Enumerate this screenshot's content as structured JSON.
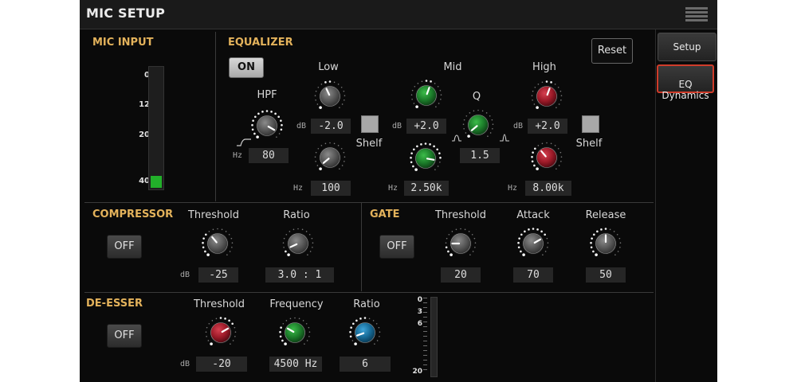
{
  "window": {
    "title": "MIC SETUP"
  },
  "icons": {
    "menu": "hamburger-menu-icon",
    "hpf_shape": "highpass-curve-icon",
    "mid_low_shape": "mid-low-curve-icon",
    "mid_high_shape": "mid-high-curve-icon"
  },
  "colors": {
    "section_title": "#e3b25b",
    "meter_level": "#22b02a",
    "knob_gray": "#585858",
    "knob_green": "#1c7d2a",
    "knob_red": "#9c1a28",
    "knob_blue": "#166a96",
    "selected_tab_border": "#d03c2a"
  },
  "sidebar": {
    "setup_label": "Setup",
    "eq_dynamics_label": "EQ\nDynamics",
    "selected": "EQ Dynamics"
  },
  "mic_input": {
    "title": "MIC INPUT",
    "scale": [
      "0",
      "12",
      "20",
      "40"
    ],
    "level_fraction": 0.1
  },
  "eq": {
    "title": "EQUALIZER",
    "on_label": "ON",
    "reset_label": "Reset",
    "hpf": {
      "label": "HPF",
      "unit": "Hz",
      "value": "80"
    },
    "low": {
      "label": "Low",
      "gain_unit": "dB",
      "gain": "-2.0",
      "shelf_label": "Shelf",
      "freq_unit": "Hz",
      "freq": "100"
    },
    "mid": {
      "label": "Mid",
      "gain_unit": "dB",
      "gain": "+2.0",
      "q_label": "Q",
      "q": "1.5",
      "freq_unit": "Hz",
      "freq": "2.50k"
    },
    "high": {
      "label": "High",
      "gain_unit": "dB",
      "gain": "+2.0",
      "shelf_label": "Shelf",
      "freq_unit": "Hz",
      "freq": "8.00k"
    }
  },
  "compressor": {
    "title": "COMPRESSOR",
    "off_label": "OFF",
    "threshold_label": "Threshold",
    "threshold_unit": "dB",
    "threshold": "-25",
    "ratio_label": "Ratio",
    "ratio": "3.0 : 1"
  },
  "gate": {
    "title": "GATE",
    "off_label": "OFF",
    "threshold_label": "Threshold",
    "threshold": "20",
    "attack_label": "Attack",
    "attack": "70",
    "release_label": "Release",
    "release": "50"
  },
  "deesser": {
    "title": "DE-ESSER",
    "off_label": "OFF",
    "threshold_label": "Threshold",
    "threshold_unit": "dB",
    "threshold": "-20",
    "frequency_label": "Frequency",
    "frequency": "4500 Hz",
    "ratio_label": "Ratio",
    "ratio": "6",
    "meter_scale": [
      "0",
      "3",
      "6",
      "20"
    ]
  }
}
